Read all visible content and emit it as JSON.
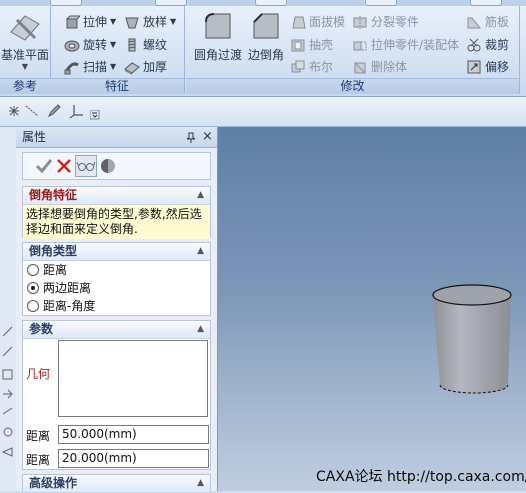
{
  "ribbon": {
    "groups": [
      {
        "label": "参考",
        "big_button": "基准平面"
      },
      {
        "label": "特征"
      },
      {
        "label": "修改"
      }
    ],
    "feature_buttons": [
      {
        "label": "拉伸",
        "dropdown": true
      },
      {
        "label": "旋转",
        "dropdown": true
      },
      {
        "label": "扫描",
        "dropdown": true
      },
      {
        "label": "放样",
        "dropdown": true
      },
      {
        "label": "螺纹",
        "dropdown": false
      },
      {
        "label": "加厚",
        "dropdown": false
      }
    ],
    "modify_big_buttons": [
      "圆角过渡",
      "边倒角"
    ],
    "modify_buttons": [
      {
        "label": "面拔模",
        "enabled": false
      },
      {
        "label": "抽壳",
        "enabled": false
      },
      {
        "label": "布尔",
        "enabled": false
      },
      {
        "label": "分裂零件",
        "enabled": false
      },
      {
        "label": "拉伸零件/装配体",
        "enabled": false
      },
      {
        "label": "删除体",
        "enabled": false
      },
      {
        "label": "筋板",
        "enabled": false
      },
      {
        "label": "裁剪",
        "enabled": true
      },
      {
        "label": "偏移",
        "enabled": true
      }
    ]
  },
  "panel": {
    "title": "属性",
    "pin": "ᵖ",
    "close": "×",
    "sections": {
      "feature": {
        "title": "倒角特征",
        "message": "选择想要倒角的类型,参数,然后选择边和面来定义倒角."
      },
      "type": {
        "title": "倒角类型",
        "options": [
          "距离",
          "两边距离",
          "距离-角度"
        ],
        "selected": 1
      },
      "params": {
        "title": "参数",
        "geometry_label": "几何",
        "distance1_label": "距离",
        "distance1_value": "50.000(mm)",
        "distance2_label": "距离",
        "distance2_value": "20.000(mm)"
      },
      "advanced": {
        "title": "高级操作"
      }
    }
  },
  "watermark": "CAXA论坛 http://top.caxa.com/",
  "colors": {
    "viewport_top": "#5f7fa6",
    "viewport_bottom": "#bfcde0",
    "cylinder": "#a3a7ad"
  }
}
